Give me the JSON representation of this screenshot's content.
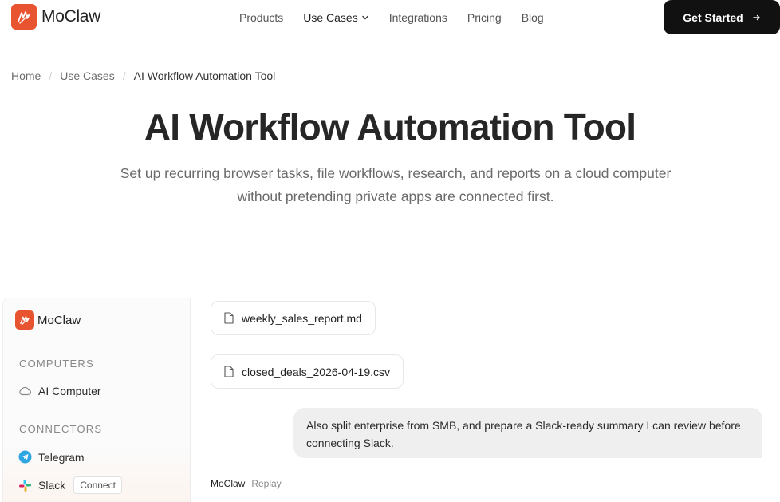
{
  "header": {
    "brand": "MoClaw",
    "nav": [
      {
        "label": "Products"
      },
      {
        "label": "Use Cases"
      },
      {
        "label": "Integrations"
      },
      {
        "label": "Pricing"
      },
      {
        "label": "Blog"
      }
    ],
    "cta_label": "Get Started"
  },
  "breadcrumb": [
    "Home",
    "Use Cases",
    "AI Workflow Automation Tool"
  ],
  "hero": {
    "title": "AI Workflow Automation Tool",
    "subtitle": "Set up recurring browser tasks, file workflows, research, and reports on a cloud computer without pretending private apps are connected first."
  },
  "app": {
    "brand": "MoClaw",
    "sections": {
      "computers": "COMPUTERS",
      "connectors": "CONNECTORS"
    },
    "computer_item": "AI Computer",
    "connectors": [
      {
        "label": "Telegram"
      },
      {
        "label": "Slack",
        "action": "Connect"
      }
    ],
    "files": [
      "weekly_sales_report.md",
      "closed_deals_2026-04-19.csv"
    ],
    "user_message": "Also split enterprise from SMB, and prepare a Slack-ready summary I can review before connecting Slack.",
    "reply_sender": "MoClaw",
    "reply_status": "Replay"
  },
  "colors": {
    "brand": "#e8542f",
    "cta_bg": "#111111",
    "telegram": "#2ca5e0"
  }
}
